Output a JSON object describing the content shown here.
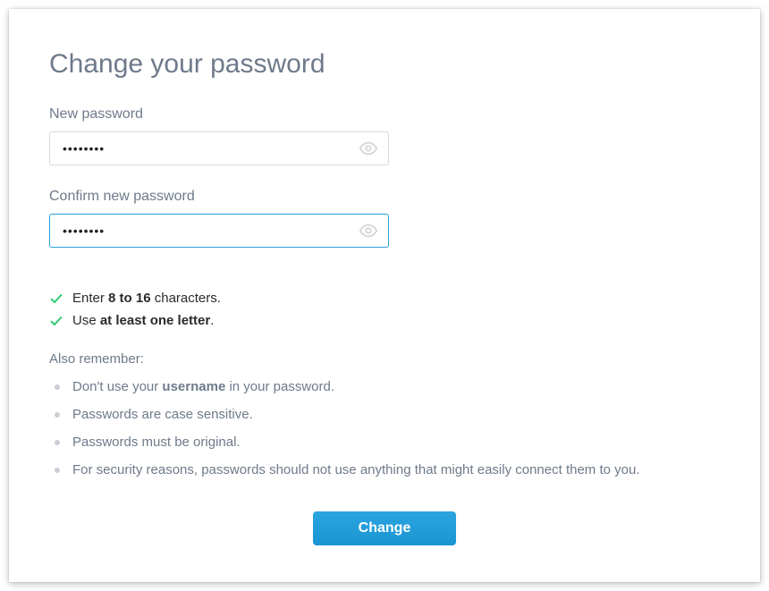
{
  "title": "Change your password",
  "fields": {
    "new_password": {
      "label": "New password",
      "value": "••••••••"
    },
    "confirm_password": {
      "label": "Confirm new password",
      "value": "••••••••"
    }
  },
  "rules": {
    "chars_pre": "Enter ",
    "chars_bold": "8 to 16",
    "chars_post": " characters.",
    "letter_pre": "Use ",
    "letter_bold": "at least one letter",
    "letter_post": "."
  },
  "remember_title": "Also remember:",
  "tips": {
    "t1_pre": "Don't use your ",
    "t1_bold": "username",
    "t1_post": " in your password.",
    "t2": "Passwords are case sensitive.",
    "t3": "Passwords must be original.",
    "t4": "For security reasons, passwords should not use anything that might easily connect them to you."
  },
  "button": {
    "change": "Change"
  },
  "colors": {
    "accent": "#2b9fd9",
    "success": "#2ecc71",
    "muted": "#6e7a8a"
  }
}
